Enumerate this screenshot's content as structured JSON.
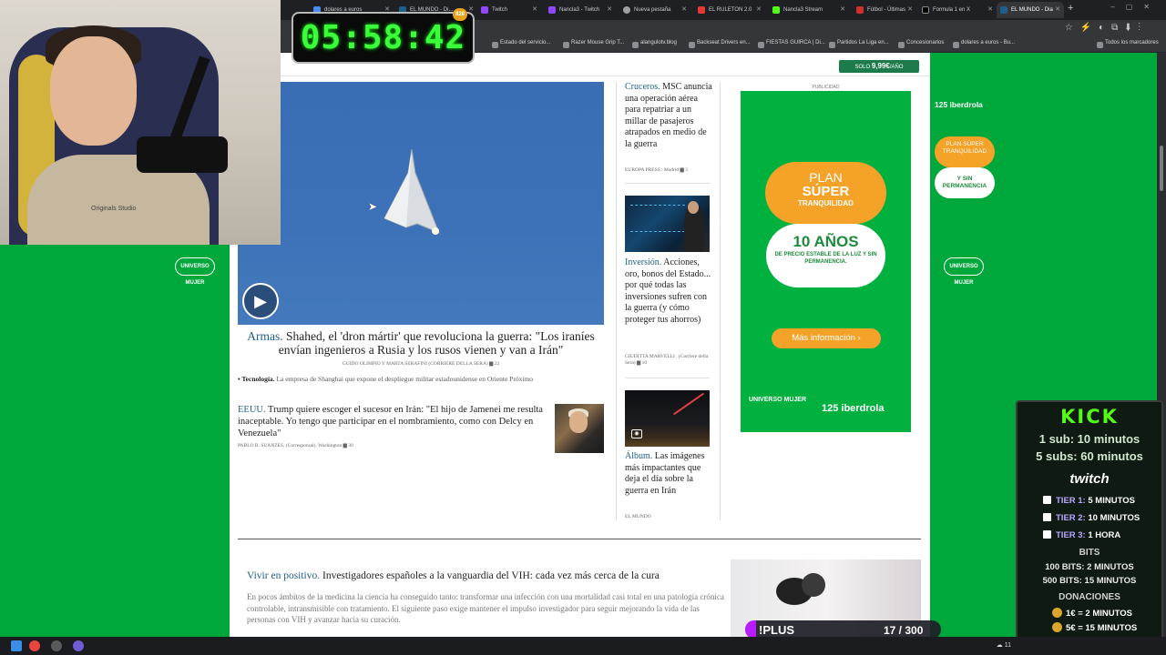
{
  "browser": {
    "tabs": [
      {
        "label": "dolares a euros"
      },
      {
        "label": "EL MUNDO - Di..."
      },
      {
        "label": "Twitch"
      },
      {
        "label": "Nancla3 - Twitch"
      },
      {
        "label": "Nueva pestaña"
      },
      {
        "label": "EL RULETON 2.0"
      },
      {
        "label": "Nancla3 Stream"
      },
      {
        "label": "Fútbol - Últimas"
      },
      {
        "label": "Formula 1 en X"
      },
      {
        "label": "EL MUNDO - Dia"
      }
    ],
    "bookmarks": [
      "Estado del servicio...",
      "Razer Mouse Grip T...",
      "alangulotv.blog",
      "Backseat Drivers en...",
      "FIESTAS GUIRCA | Di...",
      "Partidos La Liga en...",
      "Concesionarios",
      "dolares a euros - Bu..."
    ],
    "bookmarks_all": "Todos los marcadores",
    "new_tab": "+"
  },
  "page": {
    "promo_prefix": "SOLO",
    "promo_price": "9,99€",
    "promo_suffix": "/AÑO",
    "hero": {
      "kicker": "Armas.",
      "headline": " Shahed, el 'dron mártir' que revoluciona la guerra: \"Los iraníes envían ingenieros a Rusia y los rusos vienen y van a Irán\"",
      "byline": "GUIDO OLIMPIO Y MARTA SERAFINI (CORRIERE DELLA SERA)",
      "comments": "22",
      "related_label": "• Tecnología.",
      "related_text": " La empresa de Shanghai que expone el despliegue militar estadounidense en Oriente Próximo"
    },
    "story2": {
      "kicker": "EEUU.",
      "headline": " Trump quiere escoger el sucesor en Irán: \"El hijo de Jamenei me resulta inaceptable. Yo tengo que participar en el nombramiento, como con Delcy en Venezuela\"",
      "byline": "PABLO R. SUANZES, (Corresponsal). Washington",
      "comments": "30"
    },
    "col": [
      {
        "kicker": "Cruceros.",
        "headline": " MSC anuncia una operación aérea para repatriar a un millar de pasajeros atrapados en medio de la guerra",
        "byline": "EUROPA PRESS . Madrid",
        "comments": "3"
      },
      {
        "kicker": "Inversión.",
        "headline": " Acciones, oro, bonos del Estado... por qué todas las inversiones sufren con la guerra (y cómo proteger tus ahorros)",
        "byline": "GIUDITTA MARVELLI . (Corriere della Sera)",
        "comments": "10"
      },
      {
        "kicker": "Álbum.",
        "headline": " Las imágenes más impactantes que deja el día sobre la guerra en Irán",
        "byline": "EL MUNDO"
      }
    ],
    "ad": {
      "label": "PUBLICIDAD",
      "plan1": "PLAN",
      "plan2": "SÚPER",
      "plan3": "TRANQUILIDAD",
      "years": "10 AÑOS",
      "years_sub": "DE PRECIO ESTABLE DE LA LUZ Y SIN PERMANENCIA.",
      "cta": "Más información",
      "logo_left": "UNIVERSO MUJER",
      "logo_right": "125 iberdrola"
    },
    "side": {
      "brand": "125 iberdrola",
      "plan": "PLAN SÚPER TRANQUILIDAD",
      "perm": "Y SIN PERMANENCIA",
      "logo": "UNIVERSO MUJER"
    },
    "bottom": {
      "kicker": "Vivir en positivo.",
      "headline": " Investigadores españoles a la vanguardia del VIH: cada vez más cerca de la cura",
      "text": "En pocos ámbitos de la medicina la ciencia ha conseguido tanto: transformar una infección con una mortalidad casi total en una patología crónica controlable, intransmisible con tratamiento. El siguiente paso exige mantener el impulso investigador para seguir mejorando la vida de las personas con VIH y avanzar hacia su curación."
    }
  },
  "overlay": {
    "webcam_shirt": "Originals Studio",
    "timer": "05:58:42",
    "timer_badge": "828",
    "kick_logo": "KICK",
    "kick_line1": "1 sub: 10 minutos",
    "kick_line2": "5 subs: 60 minutos",
    "twitch_logo": "twitch",
    "tiers": [
      {
        "name": "TIER 1:",
        "value": "5 MINUTOS"
      },
      {
        "name": "TIER 2:",
        "value": "10 MINUTOS"
      },
      {
        "name": "TIER 3:",
        "value": "1 HORA"
      }
    ],
    "bits_header": "BITS",
    "bits1": "100 BITS: 2 MINUTOS",
    "bits2": "500 BITS: 15 MINUTOS",
    "donations_header": "DONACIONES",
    "don1": "1€ = 2 MINUTOS",
    "don2": "5€ = 15 MINUTOS",
    "plus_label": "!PLUS",
    "plus_count": "17 / 300",
    "plus_progress": 0.057
  },
  "colors": {
    "page_green": "#00a83b",
    "kick_green": "#53fc18",
    "timer_green": "#3cff3c",
    "kicker_blue": "#1f5d8a",
    "ad_orange": "#f5a228"
  },
  "icons": [
    "play-icon",
    "comment-icon",
    "camera-icon",
    "cursor-icon",
    "coin-icon",
    "twitch-tier-icon"
  ]
}
